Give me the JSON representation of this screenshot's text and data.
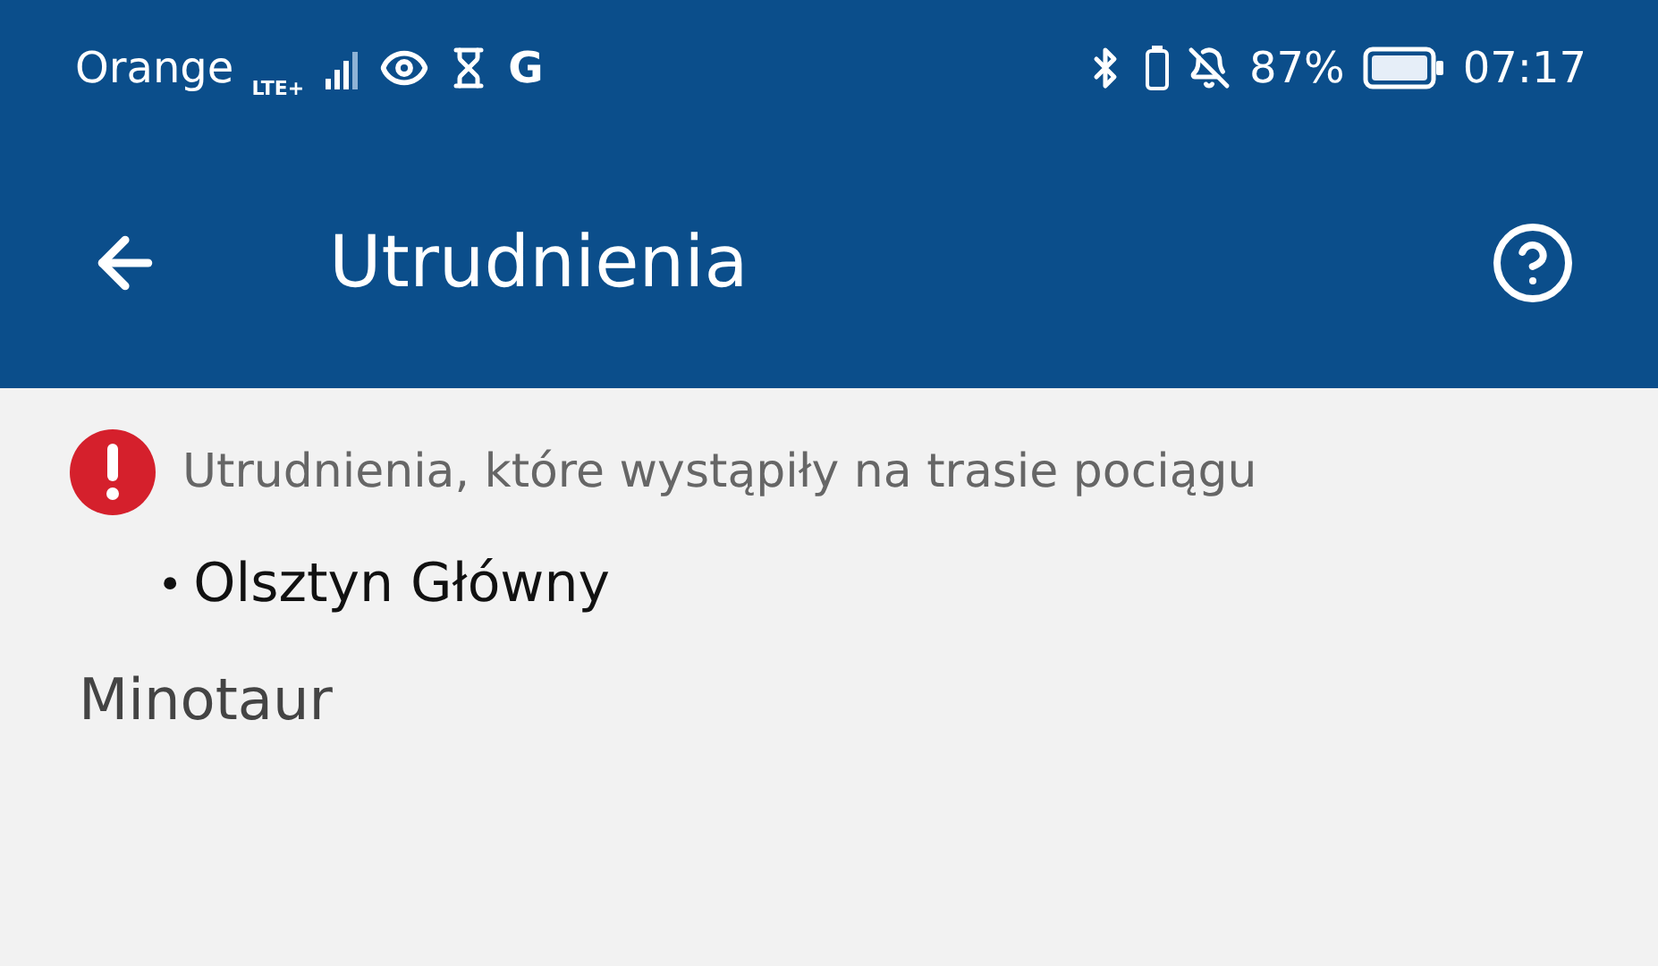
{
  "status_bar": {
    "carrier": "Orange",
    "network": "LTE+",
    "google": "G",
    "battery_percent": "87%",
    "time": "07:17"
  },
  "app_bar": {
    "title": "Utrudnienia"
  },
  "notice": {
    "text": "Utrudnienia, które wystąpiły na trasie pociągu",
    "items": [
      {
        "bullet": "•",
        "label": "Olsztyn Główny"
      }
    ]
  },
  "train_name": "Minotaur"
}
